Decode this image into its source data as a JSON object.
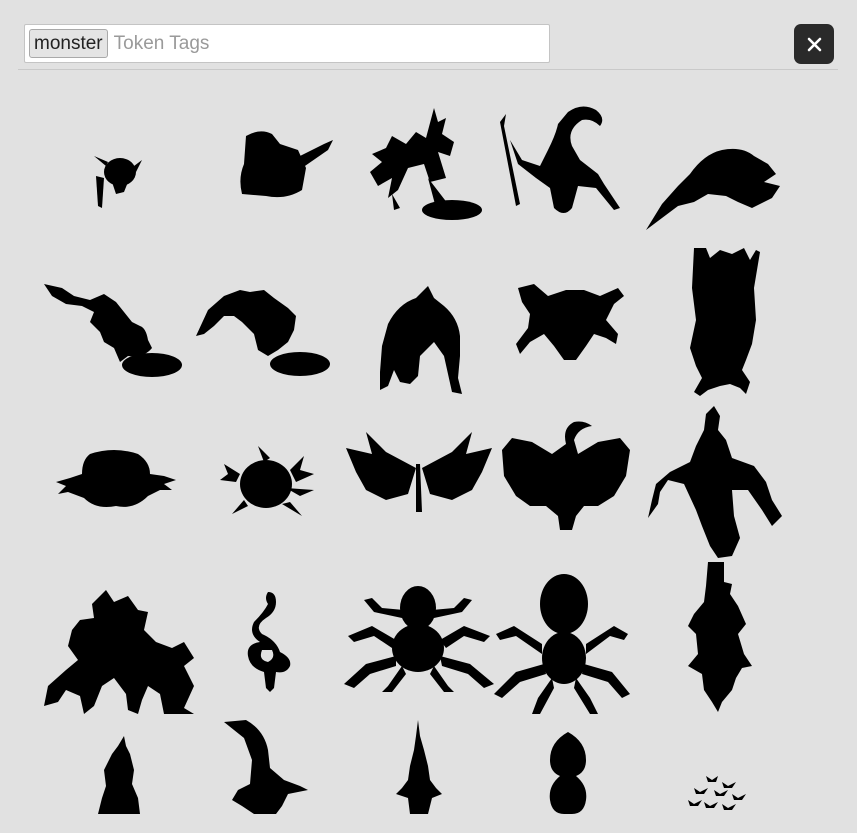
{
  "search": {
    "tags": [
      "monster"
    ],
    "placeholder": "Token Tags",
    "value": ""
  },
  "close_button": {
    "icon": "close-icon"
  },
  "tokens": [
    {
      "name": "goblin-with-dagger"
    },
    {
      "name": "crouching-ogre-with-club"
    },
    {
      "name": "spiked-beast-on-base"
    },
    {
      "name": "lizardfolk-with-spear"
    },
    {
      "name": "winged-drake-swooping"
    },
    {
      "name": "ghoul-crawling-left"
    },
    {
      "name": "ghoul-crawling-right"
    },
    {
      "name": "hunched-troll"
    },
    {
      "name": "giant-frog"
    },
    {
      "name": "hanging-ape"
    },
    {
      "name": "blob-creature"
    },
    {
      "name": "tentacled-ooze"
    },
    {
      "name": "giant-moth"
    },
    {
      "name": "bat-dragon"
    },
    {
      "name": "dragon-lizard-top-down"
    },
    {
      "name": "thorny-treant"
    },
    {
      "name": "coiled-serpent"
    },
    {
      "name": "giant-spider"
    },
    {
      "name": "giant-tick-spider"
    },
    {
      "name": "long-lizard-top-down"
    },
    {
      "name": "hooded-creature"
    },
    {
      "name": "shark-fin"
    },
    {
      "name": "spiked-tower-creature"
    },
    {
      "name": "egg-sac"
    },
    {
      "name": "bat-swarm"
    }
  ]
}
